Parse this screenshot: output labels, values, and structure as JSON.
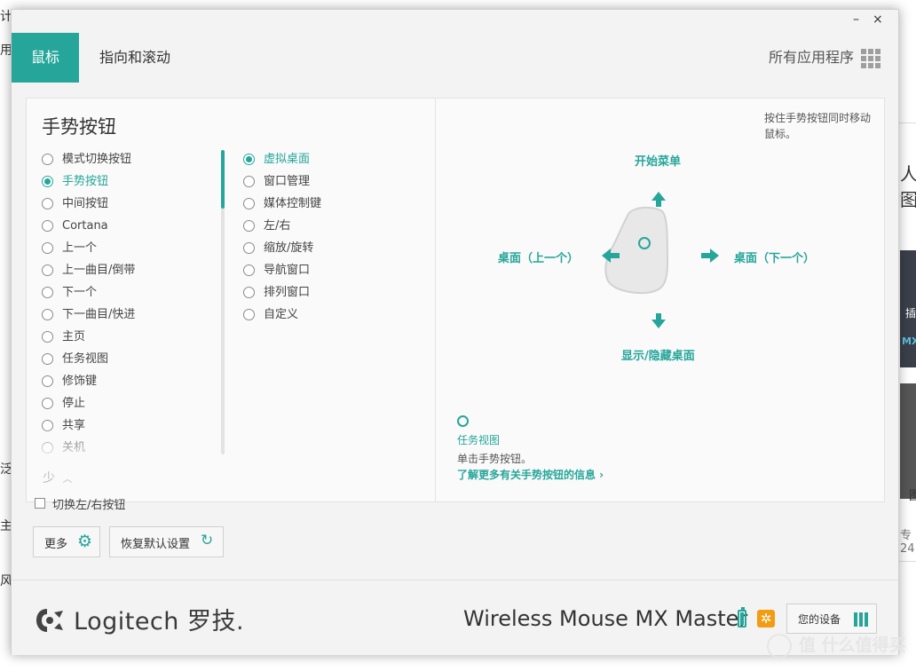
{
  "background": {
    "fragments": [
      "计",
      "用",
      "泛多",
      "主的",
      "风,",
      "人图",
      "插",
      "MX",
      "图",
      "专 24"
    ]
  },
  "window": {
    "controls": {
      "minimize": "–",
      "close": "×"
    },
    "tabs": {
      "mouse": "鼠标",
      "point_scroll": "指向和滚动"
    },
    "all_apps": "所有应用程序",
    "panel": {
      "title": "手势按钮",
      "left_options": [
        {
          "label": "模式切换按钮",
          "selected": false
        },
        {
          "label": "手势按钮",
          "selected": true
        },
        {
          "label": "中间按钮",
          "selected": false
        },
        {
          "label": "Cortana",
          "selected": false
        },
        {
          "label": "上一个",
          "selected": false
        },
        {
          "label": "上一曲目/倒带",
          "selected": false
        },
        {
          "label": "下一个",
          "selected": false
        },
        {
          "label": "下一曲目/快进",
          "selected": false
        },
        {
          "label": "主页",
          "selected": false
        },
        {
          "label": "任务视图",
          "selected": false
        },
        {
          "label": "修饰键",
          "selected": false
        },
        {
          "label": "停止",
          "selected": false
        },
        {
          "label": "共享",
          "selected": false
        },
        {
          "label": "关机",
          "selected": false
        }
      ],
      "mid_options": [
        {
          "label": "虚拟桌面",
          "selected": true
        },
        {
          "label": "窗口管理",
          "selected": false
        },
        {
          "label": "媒体控制键",
          "selected": false
        },
        {
          "label": "左/右",
          "selected": false
        },
        {
          "label": "缩放/旋转",
          "selected": false
        },
        {
          "label": "导航窗口",
          "selected": false
        },
        {
          "label": "排列窗口",
          "selected": false
        },
        {
          "label": "自定义",
          "selected": false
        }
      ],
      "less": "少",
      "hint": "按住手势按钮同时移动鼠标。",
      "directions": {
        "up": "开始菜单",
        "left": "桌面（上一个）",
        "right": "桌面（下一个）",
        "down": "显示/隐藏桌面"
      },
      "click_action": {
        "title": "任务视图",
        "desc": "单击手势按钮。",
        "link": "了解更多有关手势按钮的信息 ›"
      }
    },
    "swap_buttons": "切换左/右按钮",
    "more_button": "更多",
    "restore_button": "恢复默认设置",
    "footer": {
      "brand": "Logitech 罗技.",
      "device_name": "Wireless Mouse MX Master",
      "your_devices": "您的设备"
    }
  },
  "watermark": "值 什么值得买",
  "colors": {
    "accent": "#26a69a",
    "flow": "#f39c12"
  }
}
